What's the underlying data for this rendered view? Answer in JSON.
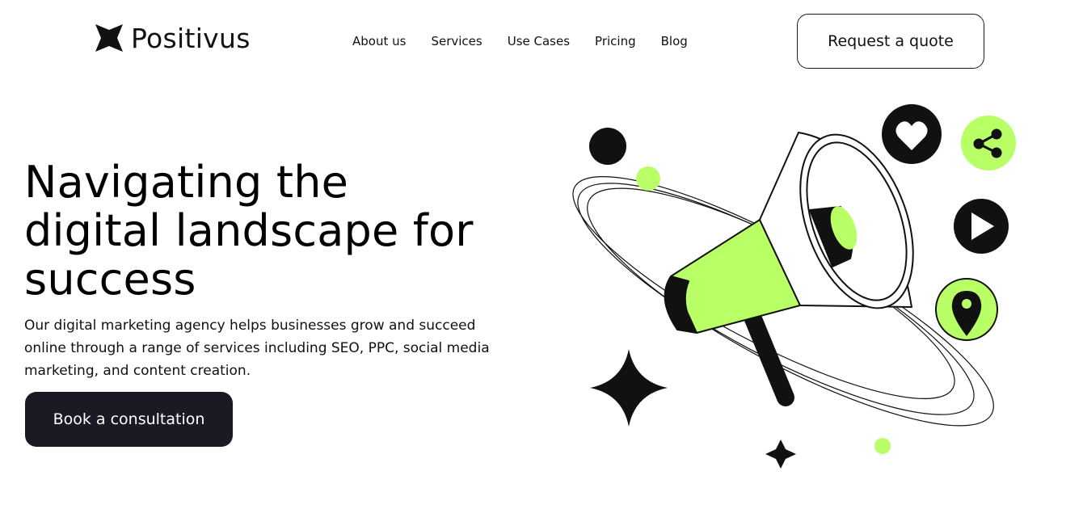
{
  "header": {
    "logo_text": "Positivus",
    "nav": [
      {
        "label": "About us"
      },
      {
        "label": "Services"
      },
      {
        "label": "Use Cases"
      },
      {
        "label": "Pricing"
      },
      {
        "label": "Blog"
      }
    ],
    "cta_label": "Request a quote"
  },
  "hero": {
    "title": "Navigating the digital landscape for success",
    "description": "Our digital marketing agency helps businesses grow and succeed online through a range of services including SEO, PPC, social media marketing, and content creation.",
    "cta_label": "Book a consultation"
  },
  "illustration": {
    "main": "megaphone-icon",
    "icons": [
      "heart-icon",
      "share-icon",
      "play-icon",
      "location-pin-icon",
      "star-sparkle-icon"
    ]
  },
  "colors": {
    "accent": "#B9FF66",
    "dark": "#191A23",
    "background": "#FFFFFF"
  }
}
